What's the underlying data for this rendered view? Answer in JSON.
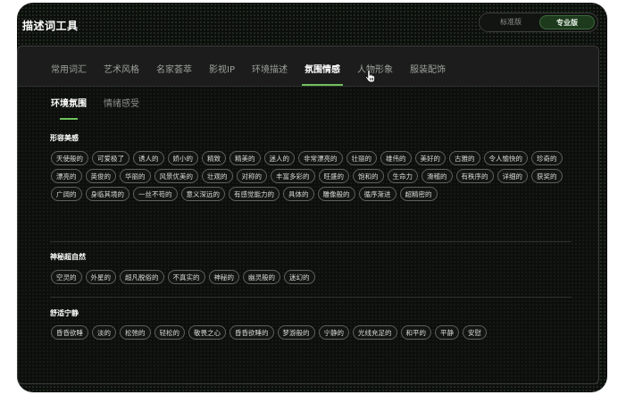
{
  "app": {
    "title": "描述词工具"
  },
  "version_toggle": {
    "standard": "标准版",
    "pro": "专业版"
  },
  "tabs": [
    {
      "label": "常用词汇"
    },
    {
      "label": "艺术风格"
    },
    {
      "label": "名家荟萃"
    },
    {
      "label": "影视IP"
    },
    {
      "label": "环境描述"
    },
    {
      "label": "氛围情感"
    },
    {
      "label": "人物形象"
    },
    {
      "label": "服装配饰"
    }
  ],
  "subtabs": [
    {
      "label": "环境氛围"
    },
    {
      "label": "情绪感受"
    }
  ],
  "sections": [
    {
      "title": "形容美感",
      "items": [
        "天使般的",
        "可爱极了",
        "诱人的",
        "娇小的",
        "精致",
        "精美的",
        "迷人的",
        "非常漂亮的",
        "壮丽的",
        "雄伟的",
        "美好的",
        "古雅的",
        "令人愉快的",
        "珍奇的",
        "漂亮的",
        "英俊的",
        "华丽的",
        "风景优美的",
        "壮观的",
        "对称的",
        "丰富多彩的",
        "旺盛的",
        "饱和的",
        "生命力",
        "滑稽的",
        "有秩序的",
        "详细的",
        "获奖的",
        "广阔的",
        "身临其境的",
        "一丝不苟的",
        "意义深远的",
        "有感觉能力的",
        "具体的",
        "雕像般的",
        "循序渐进",
        "超精密的"
      ]
    },
    {
      "title": "神秘超自然",
      "items": [
        "空灵的",
        "外星的",
        "超凡脱俗的",
        "不真实的",
        "神秘的",
        "幽灵般的",
        "迷幻的"
      ]
    },
    {
      "title": "舒适宁静",
      "items": [
        "昏昏欲睡",
        "淡的",
        "松弛的",
        "轻松的",
        "敬畏之心",
        "昏昏欲睡的",
        "梦游般的",
        "宁静的",
        "光线充足的",
        "和平的",
        "平静",
        "安慰"
      ]
    }
  ]
}
